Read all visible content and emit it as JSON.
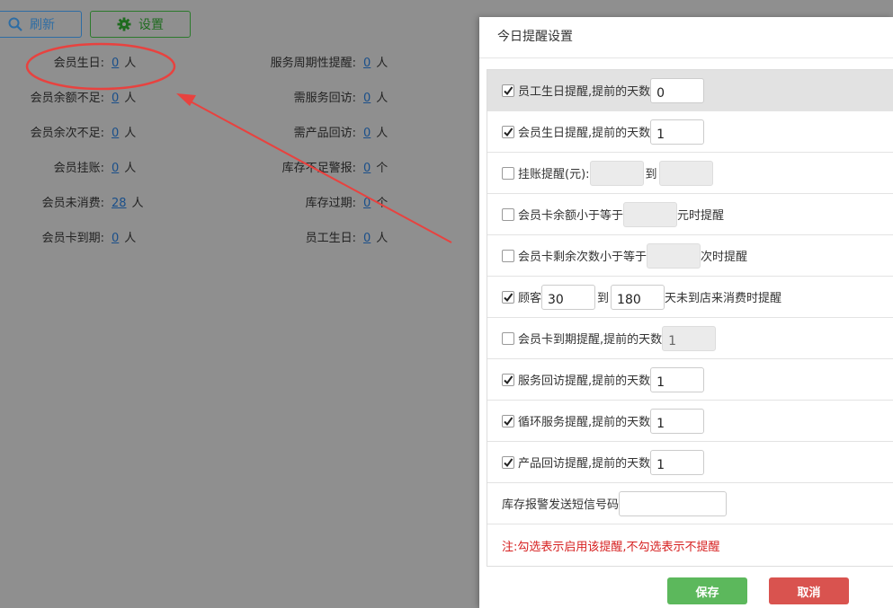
{
  "toolbar": {
    "refresh_label": "刷新",
    "settings_label": "设置"
  },
  "stats": {
    "left": [
      {
        "label": "会员生日:",
        "value": "0",
        "unit": "人"
      },
      {
        "label": "会员余额不足:",
        "value": "0",
        "unit": "人"
      },
      {
        "label": "会员余次不足:",
        "value": "0",
        "unit": "人"
      },
      {
        "label": "会员挂账:",
        "value": "0",
        "unit": "人"
      },
      {
        "label": "会员未消费:",
        "value": "28",
        "unit": "人"
      },
      {
        "label": "会员卡到期:",
        "value": "0",
        "unit": "人"
      }
    ],
    "right": [
      {
        "label": "服务周期性提醒:",
        "value": "0",
        "unit": "人"
      },
      {
        "label": "需服务回访:",
        "value": "0",
        "unit": "人"
      },
      {
        "label": "需产品回访:",
        "value": "0",
        "unit": "人"
      },
      {
        "label": "库存不足警报:",
        "value": "0",
        "unit": "个"
      },
      {
        "label": "库存过期:",
        "value": "0",
        "unit": "个"
      },
      {
        "label": "员工生日:",
        "value": "0",
        "unit": "人"
      }
    ]
  },
  "colors": {
    "annotation": "#e8423f",
    "save": "#5cb85c",
    "cancel": "#d9534f"
  },
  "dialog": {
    "title": "今日提醒设置",
    "rows": {
      "staff_birthday": {
        "label": "员工生日提醒,提前的天数",
        "value": "0",
        "checked": true
      },
      "member_birthday": {
        "label": "会员生日提醒,提前的天数",
        "value": "1",
        "checked": true
      },
      "credit": {
        "label": "挂账提醒(元):",
        "to": "到",
        "from_value": "",
        "to_value": "",
        "checked": false
      },
      "balance": {
        "label": "会员卡余额小于等于",
        "suffix": "元时提醒",
        "value": "",
        "checked": false
      },
      "times": {
        "label": "会员卡剩余次数小于等于",
        "suffix": "次时提醒",
        "value": "",
        "checked": false
      },
      "customer": {
        "label": "顾客",
        "from_value": "30",
        "to": "到",
        "to_value": "180",
        "suffix": "天未到店来消费时提醒",
        "checked": true
      },
      "card_expiry": {
        "label": "会员卡到期提醒,提前的天数",
        "value": "1",
        "checked": false
      },
      "service_visit": {
        "label": "服务回访提醒,提前的天数",
        "value": "1",
        "checked": true
      },
      "cycle_service": {
        "label": "循环服务提醒,提前的天数",
        "value": "1",
        "checked": true
      },
      "product_visit": {
        "label": "产品回访提醒,提前的天数",
        "value": "1",
        "checked": true
      },
      "sms": {
        "label": "库存报警发送短信号码",
        "value": ""
      },
      "note": "注:勾选表示启用该提醒,不勾选表示不提醒"
    },
    "save_label": "保存",
    "cancel_label": "取消"
  }
}
